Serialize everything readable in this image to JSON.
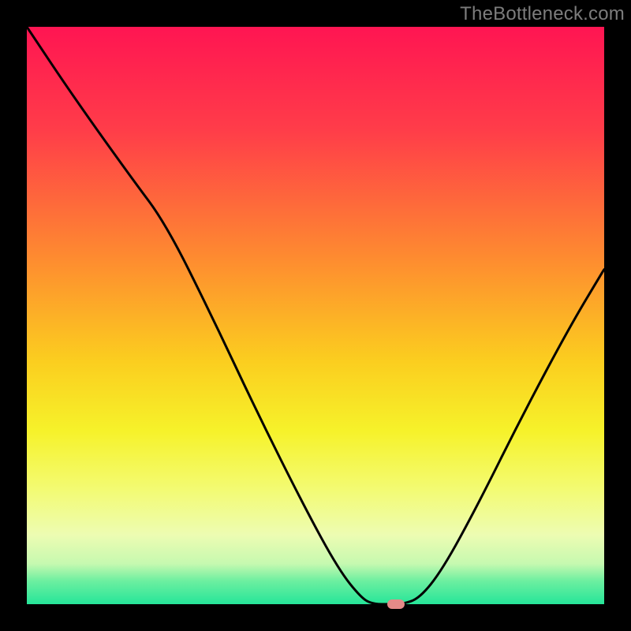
{
  "watermark": "TheBottleneck.com",
  "chart_data": {
    "type": "line",
    "title": "",
    "xlabel": "",
    "ylabel": "",
    "xlim": [
      0,
      100
    ],
    "ylim": [
      0,
      100
    ],
    "grid": false,
    "background_gradient_stops": [
      {
        "offset": 0,
        "color": "#ff1552"
      },
      {
        "offset": 18,
        "color": "#ff3d49"
      },
      {
        "offset": 40,
        "color": "#fe8b30"
      },
      {
        "offset": 58,
        "color": "#fbce1f"
      },
      {
        "offset": 70,
        "color": "#f6f22a"
      },
      {
        "offset": 80,
        "color": "#f3fb72"
      },
      {
        "offset": 88,
        "color": "#edfcb2"
      },
      {
        "offset": 93,
        "color": "#c6f9b0"
      },
      {
        "offset": 96,
        "color": "#6cefa0"
      },
      {
        "offset": 100,
        "color": "#26e599"
      }
    ],
    "series": [
      {
        "name": "bottleneck-curve",
        "x": [
          0,
          8,
          18,
          24,
          32,
          40,
          48,
          54,
          58,
          60,
          63,
          65,
          68,
          72,
          78,
          86,
          94,
          100
        ],
        "values": [
          100,
          88,
          74,
          66,
          50,
          33,
          17,
          6,
          1,
          0,
          0,
          0,
          1,
          6,
          17,
          33,
          48,
          58
        ]
      }
    ],
    "marker": {
      "x": 64,
      "y": 0,
      "color": "#e58a88"
    }
  }
}
